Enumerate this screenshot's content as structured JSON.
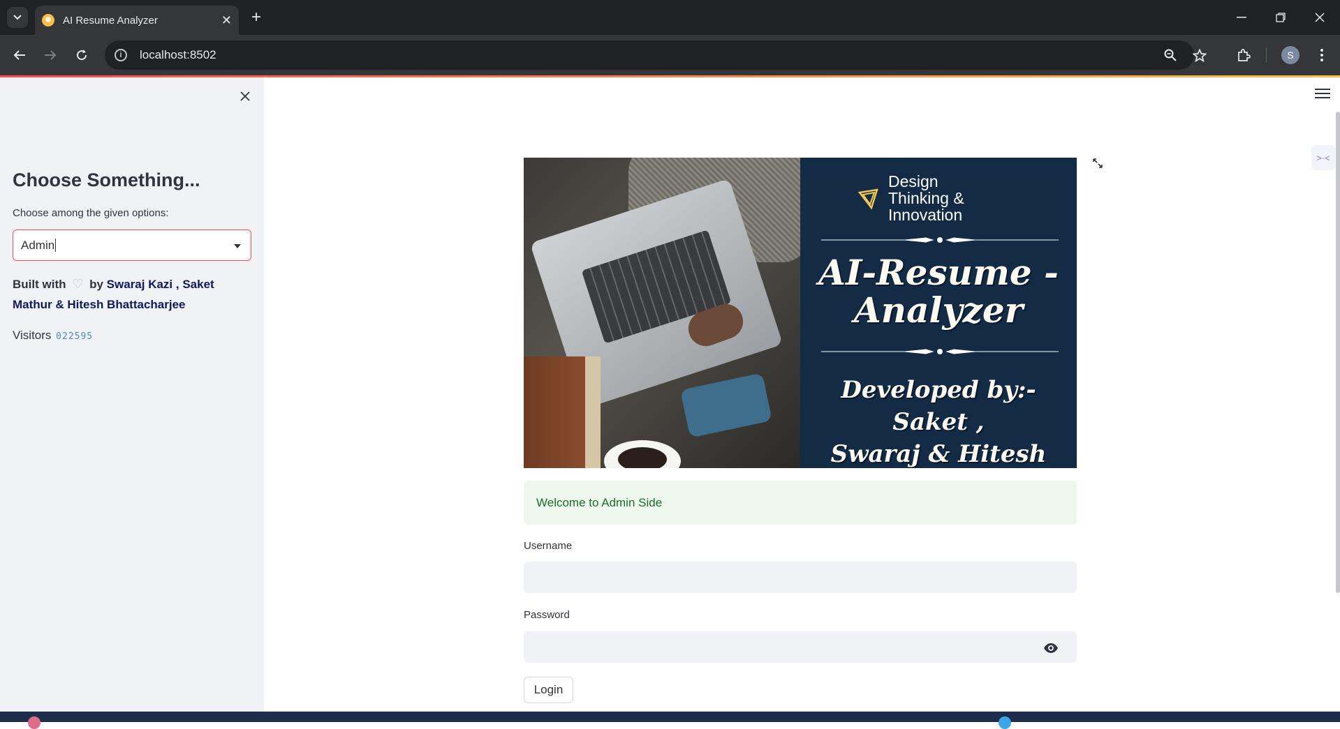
{
  "browser": {
    "tab_title": "AI Resume Analyzer",
    "tab_close": "✕",
    "new_tab": "+",
    "address": "localhost:8502",
    "profile_initial": "S",
    "icons": [
      "tab-search-icon",
      "back-icon",
      "forward-icon",
      "reload-icon",
      "site-info-icon",
      "zoom-icon",
      "bookmark-star-icon",
      "extensions-icon",
      "menu-dots-icon"
    ]
  },
  "sidebar": {
    "heading": "Choose Something...",
    "select_label": "Choose among the given options:",
    "select_value": "Admin",
    "built_with_prefix": "Built with",
    "built_with_by": "by",
    "authors": "Swaraj Kazi , Saket Mathur & Hitesh Bhattacharjee",
    "visitors_label": "Visitors",
    "visitors_count": "022595"
  },
  "banner": {
    "brand_line1": "Design",
    "brand_line2": "Thinking &",
    "brand_line3": "Innovation",
    "title_line1": "AI-Resume -",
    "title_line2": "Analyzer",
    "dev_line1": "Developed by:- Saket ,",
    "dev_line2": "Swaraj & Hitesh"
  },
  "main": {
    "alert_text": "Welcome to Admin Side",
    "username_label": "Username",
    "username_value": "",
    "password_label": "Password",
    "password_value": "",
    "login_label": "Login"
  },
  "colors": {
    "accent": "#ff4b4b",
    "sidebar_bg": "#f0f2f6",
    "poster_bg": "#132b45",
    "success_bg": "#eef7ec",
    "success_text": "#1f6c2c"
  }
}
